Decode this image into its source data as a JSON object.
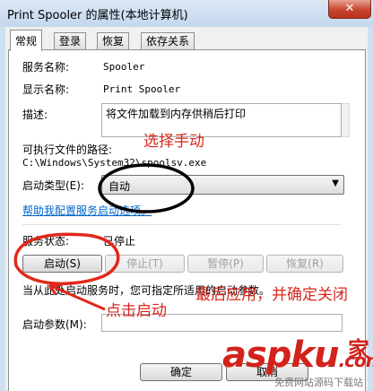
{
  "window": {
    "title": "Print Spooler 的属性(本地计算机)",
    "close_glyph": "✕"
  },
  "tabs": [
    {
      "label": "常规",
      "active": true
    },
    {
      "label": "登录",
      "active": false
    },
    {
      "label": "恢复",
      "active": false
    },
    {
      "label": "依存关系",
      "active": false
    }
  ],
  "general": {
    "service_name_label": "服务名称:",
    "service_name": "Spooler",
    "display_name_label": "显示名称:",
    "display_name": "Print Spooler",
    "description_label": "描述:",
    "description": "将文件加载到内存供稍后打印",
    "exe_path_label": "可执行文件的路径:",
    "exe_path": "C:\\Windows\\System32\\spoolsv.exe",
    "startup_type_label": "启动类型(E):",
    "startup_type_value": "自动",
    "help_link": "帮助我配置服务启动选项。",
    "status_label": "服务状态:",
    "status_value": "已停止",
    "buttons": {
      "start": "启动(S)",
      "stop": "停止(T)",
      "pause": "暂停(P)",
      "resume": "恢复(R)"
    },
    "hint": "当从此处启动服务时，您可指定所适用的启动参数。",
    "params_label": "启动参数(M):"
  },
  "dialog_buttons": {
    "ok": "确定",
    "cancel": "取消"
  },
  "annotations": {
    "choose_manual": "选择手动",
    "apply_and_confirm": "最后应用，并确定关闭",
    "click_start": "点击启动",
    "color": "#d8271c"
  },
  "watermark": {
    "brand": "aspku",
    "suffix": ".com",
    "glyph": "家",
    "tagline": "免费网站源码下载站"
  }
}
